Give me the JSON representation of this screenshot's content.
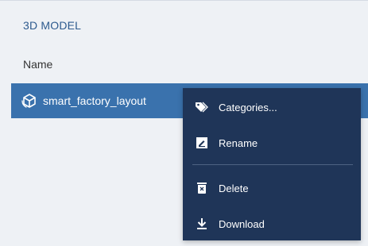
{
  "panel": {
    "section_title": "3D MODEL",
    "column_header": "Name"
  },
  "rows": [
    {
      "label": "smart_factory_layout",
      "icon": "cube-model-icon",
      "selected": true
    }
  ],
  "context_menu": {
    "items": [
      {
        "label": "Categories...",
        "icon": "tag-icon"
      },
      {
        "label": "Rename",
        "icon": "rename-icon"
      },
      {
        "label": "Delete",
        "icon": "trash-icon"
      },
      {
        "label": "Download",
        "icon": "download-icon"
      }
    ]
  },
  "colors": {
    "background": "#eef1f5",
    "section_title": "#2d5a8e",
    "selected_row": "#3a72ad",
    "menu_background": "#1f3558",
    "menu_text": "#ffffff"
  }
}
